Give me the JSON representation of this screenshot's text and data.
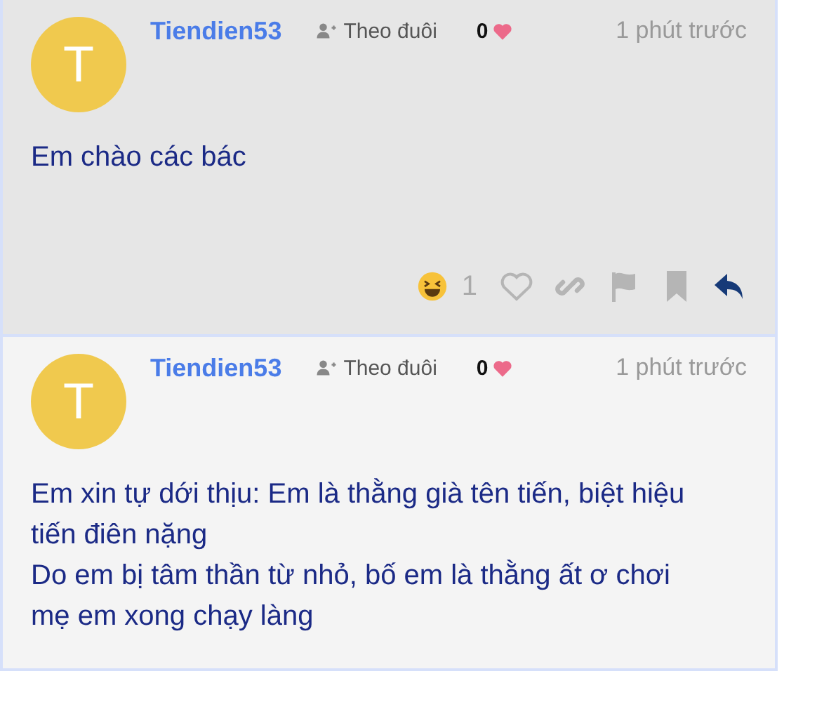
{
  "posts": [
    {
      "highlighted": true,
      "avatar_letter": "T",
      "author": "Tiendien53",
      "follow_label": "Theo đuôi",
      "likes": "0",
      "time": "1 phút trước",
      "paragraphs": [
        "Em chào các bác"
      ],
      "reaction_count": "1"
    },
    {
      "highlighted": false,
      "avatar_letter": "T",
      "author": "Tiendien53",
      "follow_label": "Theo đuôi",
      "likes": "0",
      "time": "1 phút trước",
      "paragraphs": [
        "Em xin tự dới thịu: Em là thằng già tên tiến, biệt hiệu tiến điên nặng",
        "Do em bị tâm thần từ nhỏ, bố em là thằng ất ơ chơi mẹ em xong chạy làng"
      ]
    }
  ]
}
